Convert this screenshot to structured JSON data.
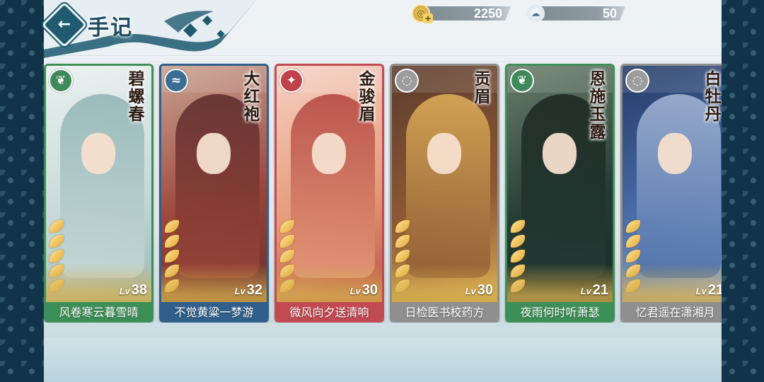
{
  "header": {
    "title": "手记",
    "back_label": "←"
  },
  "currencies": [
    {
      "name": "coin",
      "icon": "coin-icon",
      "amount": "2250"
    },
    {
      "name": "cloud",
      "icon": "cloud-icon",
      "amount": "50"
    }
  ],
  "cards": [
    {
      "vertical_name": "碧螺春",
      "level_prefix": "Lv",
      "level": "38",
      "caption": "风卷寒云暮雪晴",
      "element": "leaf-icon",
      "element_color": "#3f8a5a",
      "caption_color": "#3c8f57",
      "art_colors": [
        "#e9f1ef",
        "#c7d8d8",
        "#8fb3b3"
      ]
    },
    {
      "vertical_name": "大红袍",
      "level_prefix": "Lv",
      "level": "32",
      "caption": "不觉黄粱一梦游",
      "element": "water-icon",
      "element_color": "#3a6c94",
      "caption_color": "#2f5f8a",
      "art_colors": [
        "#c9a292",
        "#9b4538",
        "#5a2a2c"
      ]
    },
    {
      "vertical_name": "金骏眉",
      "level_prefix": "Lv",
      "level": "30",
      "caption": "微风向夕送清响",
      "element": "fire-icon",
      "element_color": "#c0414a",
      "caption_color": "#c24a52",
      "art_colors": [
        "#f6d1c4",
        "#e49a78",
        "#b2433f"
      ]
    },
    {
      "vertical_name": "贡眉",
      "level_prefix": "Lv",
      "level": "30",
      "caption": "日检医书校药方",
      "element": "wind-icon",
      "element_color": "#9c9c9c",
      "caption_color": "#8f8f8f",
      "art_colors": [
        "#5c3b2c",
        "#8d5a34",
        "#e2b25a"
      ]
    },
    {
      "vertical_name": "恩施玉露",
      "level_prefix": "Lv",
      "level": "21",
      "caption": "夜雨何时听萧瑟",
      "element": "leaf-icon",
      "element_color": "#3f8a5a",
      "caption_color": "#3c8f57",
      "art_colors": [
        "#6a7e6a",
        "#243b35",
        "#1b2620"
      ]
    },
    {
      "vertical_name": "白牡丹",
      "level_prefix": "Lv",
      "level": "21",
      "caption": "忆君遥在潇湘月",
      "element": "wind-icon",
      "element_color": "#9c9c9c",
      "caption_color": "#8f8f8f",
      "art_colors": [
        "#233a66",
        "#4b6fa8",
        "#a8b9d8"
      ]
    }
  ]
}
